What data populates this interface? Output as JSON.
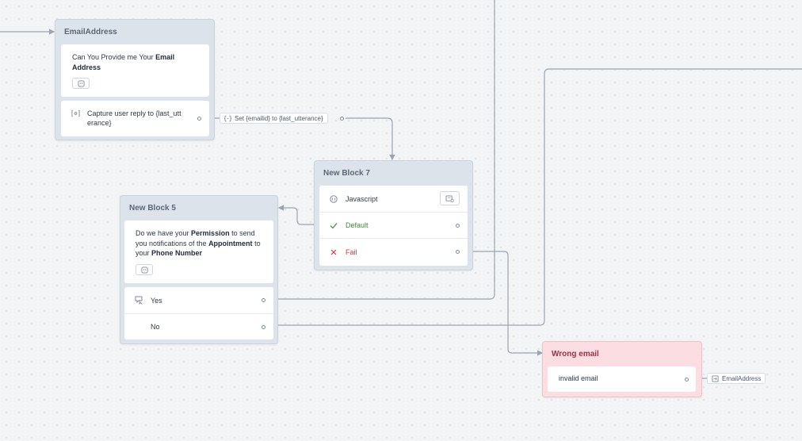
{
  "blocks": {
    "email_address": {
      "title": "EmailAddress",
      "message": {
        "prefix": "Can You Provide me Your ",
        "bold": "Email Address"
      },
      "capture_label": "Capture user reply to {last_utt erance}"
    },
    "set_chip": {
      "label": "Set {emailid} to {last_utterance}"
    },
    "new_block_7": {
      "title": "New Block 7",
      "script_label": "Javascript",
      "default_label": "Default",
      "fail_label": "Fail"
    },
    "new_block_5": {
      "title": "New Block 5",
      "message": {
        "p1": "Do we have your ",
        "b1": "Permission",
        "p2": " to send you notifications of the ",
        "b2": "Appointment",
        "p3": " to your ",
        "b3": "Phone Number"
      },
      "yes_label": "Yes",
      "no_label": "No"
    },
    "wrong_email": {
      "title": "Wrong email",
      "message_label": "invalid email"
    },
    "goto_chip": {
      "label": "EmailAddress"
    }
  },
  "colors": {
    "default_green": "#3f8a3a",
    "fail_red": "#c9394a",
    "wrong_bg": "#fbdde2",
    "wire": "#9aa4b2"
  }
}
